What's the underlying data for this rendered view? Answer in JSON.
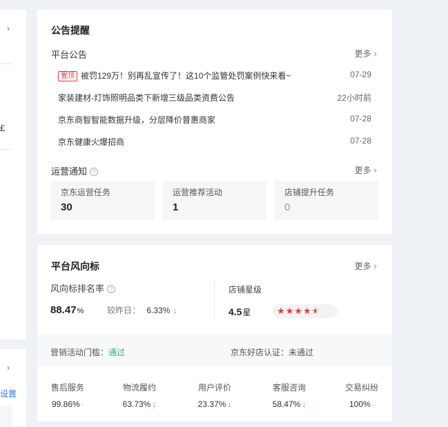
{
  "left_partial": {
    "chevron": "›",
    "fragment": "£",
    "chevron2": "›",
    "link": "设置"
  },
  "notice": {
    "title": "公告提醒",
    "platform_label": "平台公告",
    "more": "更多",
    "news": [
      {
        "badge": "置顶",
        "text": "被罚129万！别再乱宣传了！这10个监管处罚案例快来看~",
        "date": "07-29"
      },
      {
        "text": "家装建材-灯饰照明品类下新增三级品类资费公告",
        "date": "22小时前"
      },
      {
        "text": "京东商智智能数据升级，分层降价普惠商家",
        "date": "07-28"
      },
      {
        "text": "京东健康火爆招商",
        "date": "07-28"
      }
    ],
    "ops_label": "运营通知",
    "ops_more": "更多",
    "tasks": [
      {
        "label": "京东运营任务",
        "value": "30"
      },
      {
        "label": "运营推荐活动",
        "value": "1"
      },
      {
        "label": "店铺提升任务",
        "value": "0"
      }
    ]
  },
  "wind": {
    "title": "平台风向标",
    "more": "更多",
    "rank_label": "风向标排名率",
    "rank_value": "88.47",
    "rank_unit": "%",
    "compare_label": "较昨日：",
    "compare_value": "6.33%",
    "star_label": "店铺星级",
    "star_value": "4.5",
    "star_unit": "星",
    "star_rating": 4.5,
    "threshold_label": "营销活动门槛：",
    "threshold_value": "通过",
    "good_store_label": "京东好店认证：",
    "good_store_value": "未通过",
    "metrics": [
      {
        "label": "售后服务",
        "value": "99.86%",
        "trend": "flat"
      },
      {
        "label": "物流履约",
        "value": "63.73%",
        "trend": "down"
      },
      {
        "label": "用户评价",
        "value": "23.37%",
        "trend": "down"
      },
      {
        "label": "客服咨询",
        "value": "58.47%",
        "trend": "down"
      },
      {
        "label": "交易纠纷",
        "value": "100%",
        "trend": "flat"
      }
    ]
  },
  "colors": {
    "accent_red": "#e4393c",
    "ok_green": "#2bb48c",
    "background": "#eef1f6"
  }
}
